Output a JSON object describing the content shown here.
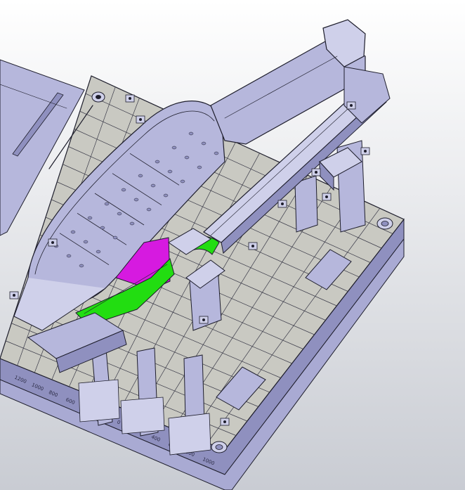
{
  "viewport": {
    "background_top": "#ffffff",
    "background_bottom": "#c9ccd3"
  },
  "colors": {
    "steel": "#b6b7dc",
    "steel_light": "#cfd0ea",
    "steel_dark": "#8f90bf",
    "edge": "#1e1e2c",
    "grid_plate": "#c9c9c2",
    "grid_line": "#3a3a48",
    "highlight_green": "#22dd11",
    "highlight_magenta": "#d61ae0"
  },
  "parts": {
    "baseplate": "baseplate",
    "aux_table": "aux-table",
    "skin_panel": "skin-panel",
    "boom_arm": "boom-arm",
    "rail_beam": "rail-beam",
    "support_columns": "support-columns",
    "green_bracket": "green-bracket",
    "magenta_bracket": "magenta-bracket",
    "green_saddle": "green-saddle",
    "clamp_towers": "clamp-towers",
    "leveling_feet": "leveling-feet"
  },
  "scale_labels": [
    "1200",
    "1000",
    "800",
    "600",
    "400",
    "200",
    "0",
    "200",
    "400",
    "600",
    "800",
    "1000"
  ]
}
